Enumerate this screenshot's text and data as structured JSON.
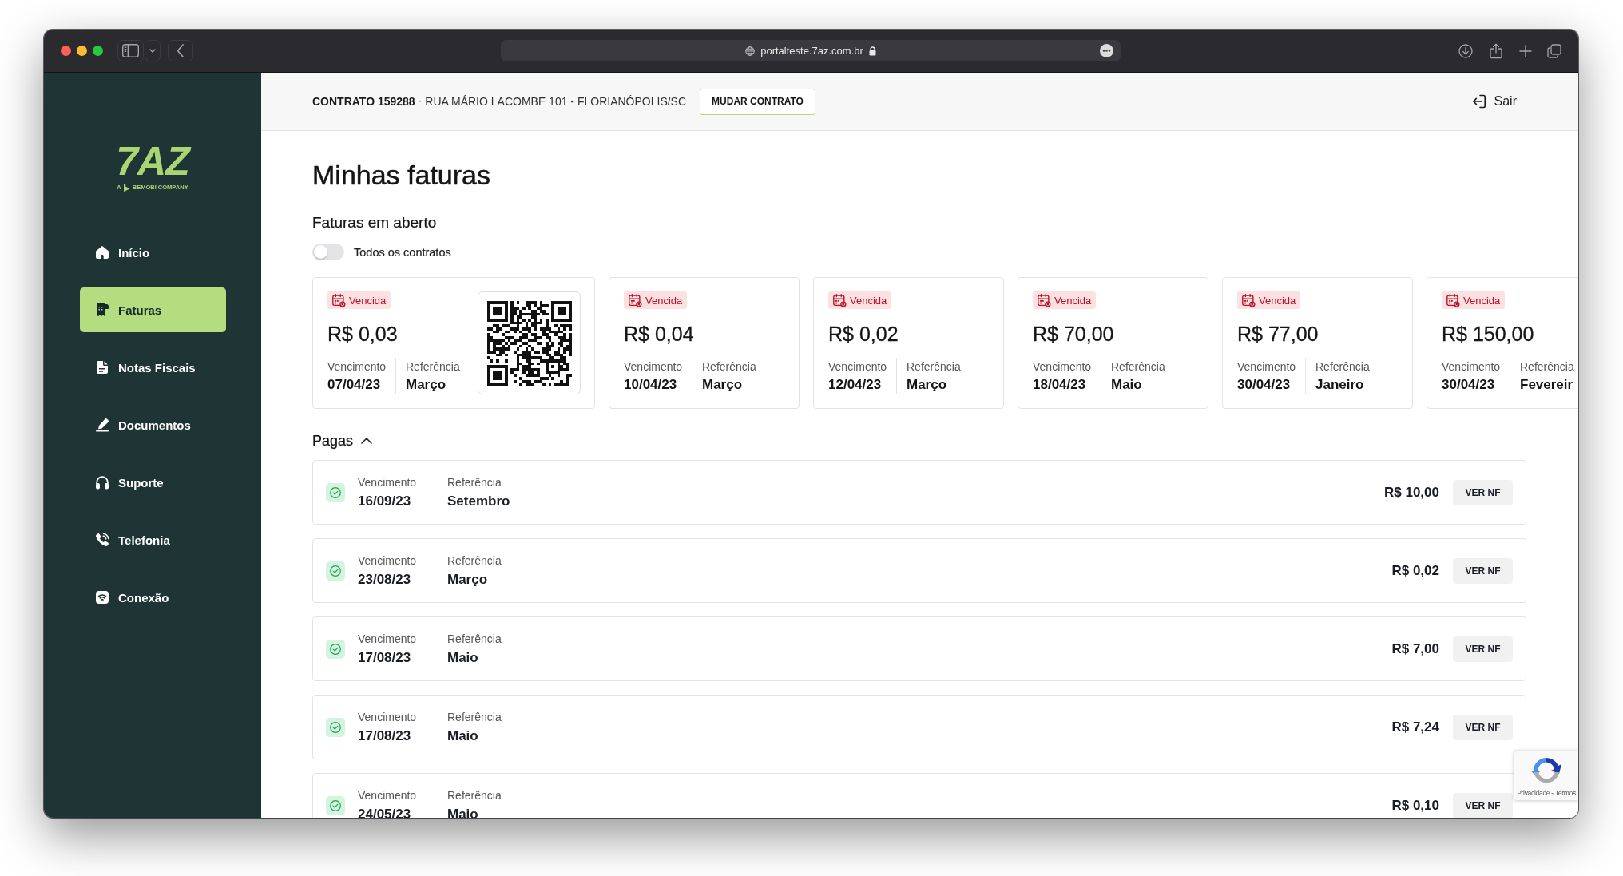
{
  "browser": {
    "url": "portalteste.7az.com.br"
  },
  "sidebar": {
    "logo": "7AZ",
    "tagline_prefix": "A",
    "tagline": "BEMOBI COMPANY",
    "items": [
      {
        "label": "Início",
        "selected": false
      },
      {
        "label": "Faturas",
        "selected": true
      },
      {
        "label": "Notas Fiscais",
        "selected": false
      },
      {
        "label": "Documentos",
        "selected": false
      },
      {
        "label": "Suporte",
        "selected": false
      },
      {
        "label": "Telefonia",
        "selected": false
      },
      {
        "label": "Conexão",
        "selected": false
      }
    ]
  },
  "header": {
    "contract": "CONTRATO 159288",
    "separator": "·",
    "address": "RUA MÁRIO LACOMBE 101 - FLORIANÓPOLIS/SC",
    "change_button": "MUDAR CONTRATO",
    "logout": "Sair"
  },
  "page_title": "Minhas faturas",
  "open_invoices": {
    "heading": "Faturas em aberto",
    "toggle": {
      "label": "Todos os contratos",
      "on": false
    },
    "cards": [
      {
        "status": "Vencida",
        "amount": "R$ 0,03",
        "due_label": "Vencimento",
        "due": "07/04/23",
        "reference_label": "Referência",
        "reference": "Março",
        "has_qr_code": true
      },
      {
        "status": "Vencida",
        "amount": "R$ 0,04",
        "due_label": "Vencimento",
        "due": "10/04/23",
        "reference_label": "Referência",
        "reference": "Março",
        "has_qr_code": false
      },
      {
        "status": "Vencida",
        "amount": "R$ 0,02",
        "due_label": "Vencimento",
        "due": "12/04/23",
        "reference_label": "Referência",
        "reference": "Março",
        "has_qr_code": false
      },
      {
        "status": "Vencida",
        "amount": "R$ 70,00",
        "due_label": "Vencimento",
        "due": "18/04/23",
        "reference_label": "Referência",
        "reference": "Maio",
        "has_qr_code": false
      },
      {
        "status": "Vencida",
        "amount": "R$ 77,00",
        "due_label": "Vencimento",
        "due": "30/04/23",
        "reference_label": "Referência",
        "reference": "Janeiro",
        "has_qr_code": false
      },
      {
        "status": "Vencida",
        "amount": "R$ 150,00",
        "due_label": "Vencimento",
        "due": "30/04/23",
        "reference_label": "Referência",
        "reference": "Fevereir",
        "has_qr_code": false
      }
    ]
  },
  "paid_invoices": {
    "heading": "Pagas",
    "expanded": true,
    "rows": [
      {
        "due_label": "Vencimento",
        "due": "16/09/23",
        "reference_label": "Referência",
        "reference": "Setembro",
        "amount": "R$ 10,00",
        "button": "VER NF"
      },
      {
        "due_label": "Vencimento",
        "due": "23/08/23",
        "reference_label": "Referência",
        "reference": "Março",
        "amount": "R$ 0,02",
        "button": "VER NF"
      },
      {
        "due_label": "Vencimento",
        "due": "17/08/23",
        "reference_label": "Referência",
        "reference": "Maio",
        "amount": "R$ 7,00",
        "button": "VER NF"
      },
      {
        "due_label": "Vencimento",
        "due": "17/08/23",
        "reference_label": "Referência",
        "reference": "Maio",
        "amount": "R$ 7,24",
        "button": "VER NF"
      },
      {
        "due_label": "Vencimento",
        "due": "24/05/23",
        "reference_label": "Referência",
        "reference": "Maio",
        "amount": "R$ 0,10",
        "button": "VER NF"
      }
    ]
  },
  "captcha_badge": {
    "links": "Privacidade - Termos"
  }
}
